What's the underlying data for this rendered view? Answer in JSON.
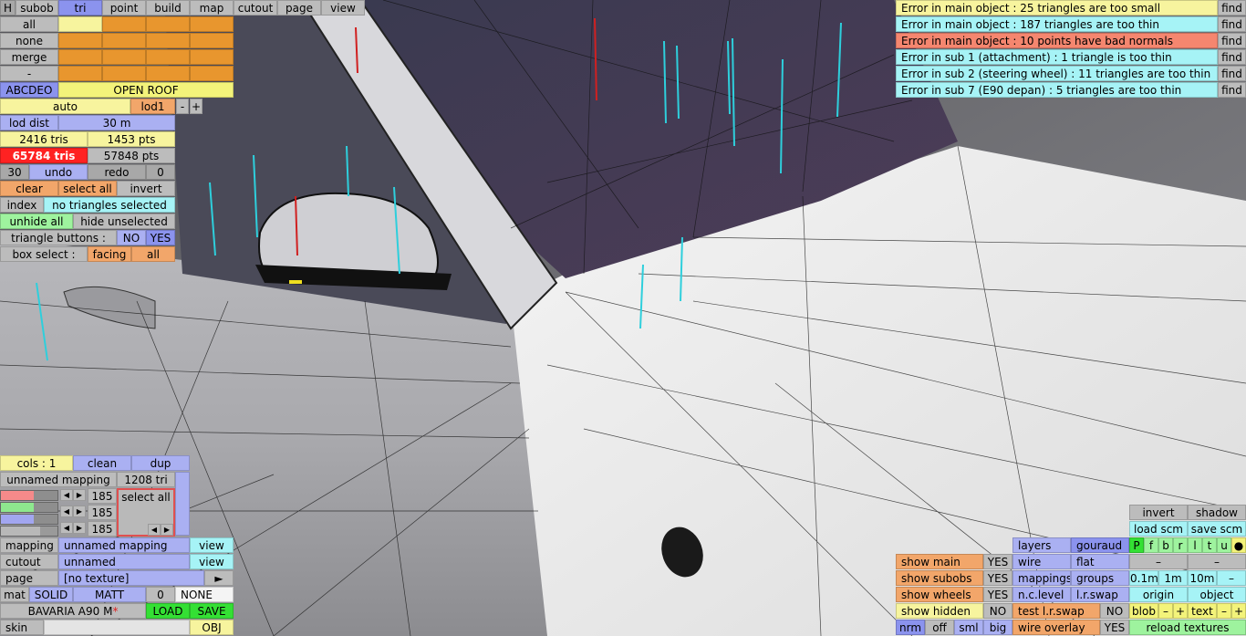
{
  "topbar": [
    "H",
    "subob",
    "tri",
    "point",
    "build",
    "map",
    "cutout",
    "page",
    "view"
  ],
  "left": {
    "rows": [
      "all",
      "none",
      "merge",
      "-"
    ],
    "abcdeo": "ABCDEO",
    "open_roof": "OPEN ROOF",
    "auto": "auto",
    "lod": "lod1",
    "minus": "-",
    "plus": "+",
    "lod_dist": "lod dist",
    "lod_dist_val": "30 m",
    "tris": "2416 tris",
    "pts": "1453 pts",
    "total_tris": "65784 tris",
    "total_pts": "57848 pts",
    "undo_count": "30",
    "undo": "undo",
    "redo": "redo",
    "redo_count": "0",
    "clear": "clear",
    "select_all": "select all",
    "invert": "invert",
    "index": "index",
    "selection_status": "no triangles selected",
    "unhide_all": "unhide all",
    "hide_unselected": "hide unselected",
    "triangle_buttons": "triangle buttons :",
    "no": "NO",
    "yes": "YES",
    "box_select": "box select :",
    "facing": "facing",
    "all": "all"
  },
  "bottom_left": {
    "cols": "cols : 1",
    "clean": "clean",
    "dup": "dup",
    "mapping_name": "unnamed mapping",
    "mapping_tris": "1208 tri",
    "rgb": [
      "185",
      "185",
      "185"
    ],
    "select_all": "select all",
    "rows": [
      {
        "label": "mapping",
        "value": "unnamed mapping",
        "action": "view"
      },
      {
        "label": "cutout",
        "value": "unnamed",
        "action": "view"
      },
      {
        "label": "page",
        "value": "[no texture]",
        "action": "►"
      }
    ],
    "mat": "mat",
    "solid": "SOLID",
    "matt": "MATT",
    "zero": "0",
    "none": "NONE",
    "car_name": "BAVARIA A90 M",
    "asterisk": "*",
    "load": "LOAD",
    "save": "SAVE",
    "skin": "skin",
    "obj": "OBJ"
  },
  "errors": [
    {
      "text": "Error in main object : 25 triangles are too small",
      "color": "#f7f49e"
    },
    {
      "text": "Error in main object : 187 triangles are too thin",
      "color": "#a6f3f6"
    },
    {
      "text": "Error in main object : 10 points have bad normals",
      "color": "#f5866f"
    },
    {
      "text": "Error in sub 1 (attachment) : 1 triangle is too thin",
      "color": "#a6f3f6"
    },
    {
      "text": "Error in sub 2 (steering wheel) : 11 triangles are too thin",
      "color": "#a6f3f6"
    },
    {
      "text": "Error in sub 7 (E90 depan) : 5 triangles are too thin",
      "color": "#a6f3f6"
    }
  ],
  "find": "find",
  "bottom_right": {
    "invert": "invert",
    "shadow": "shadow",
    "load_scm": "load scm",
    "save_scm": "save scm",
    "letters": [
      "P",
      "f",
      "b",
      "r",
      "l",
      "t",
      "u",
      "●"
    ],
    "dash": "–",
    "show": [
      {
        "label": "show main",
        "v": "YES"
      },
      {
        "label": "show subobs",
        "v": "YES"
      },
      {
        "label": "show wheels",
        "v": "YES"
      },
      {
        "label": "show hidden",
        "v": "NO"
      }
    ],
    "layers": "layers",
    "gouraud": "gouraud",
    "wire": "wire",
    "flat": "flat",
    "mappings": "mappings",
    "groups": "groups",
    "nc_level": "n.c.level",
    "lr_swap": "l.r.swap",
    "test_lr_swap": "test l.r.swap",
    "test_no": "NO",
    "d01": "0.1m",
    "d1": "1m",
    "d10": "10m",
    "dminus": "–",
    "origin": "origin",
    "object": "object",
    "blob": "blob",
    "text": "text",
    "m": "–",
    "p": "+",
    "nrm": "nrm",
    "off": "off",
    "sml": "sml",
    "big": "big",
    "wire_overlay": "wire overlay",
    "wo_yes": "YES",
    "reload": "reload textures"
  }
}
